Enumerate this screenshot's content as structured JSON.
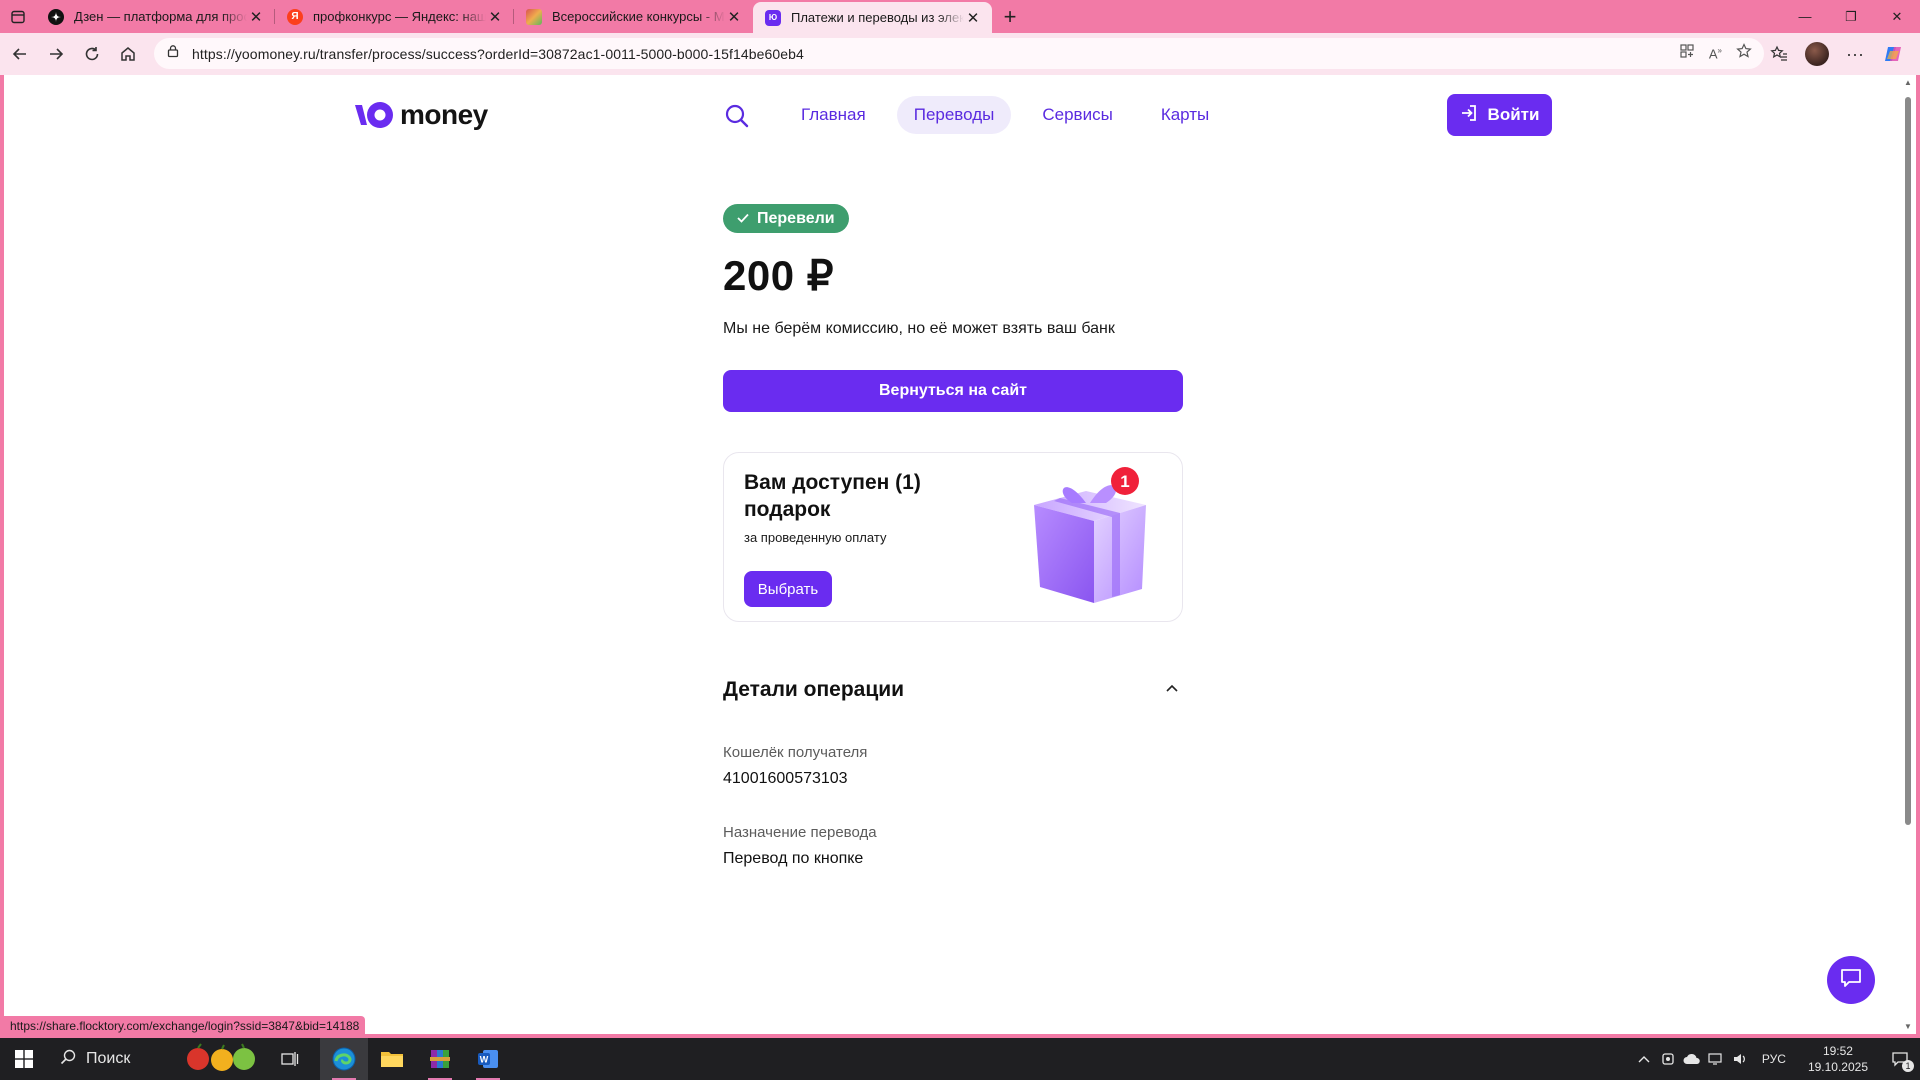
{
  "browser": {
    "tabs": [
      {
        "title": "Дзен — платформа для просмотра",
        "favicon": "dzen-icon",
        "active": false
      },
      {
        "title": "профконкурс — Яндекс: нашлось",
        "favicon": "yandex-icon",
        "active": false
      },
      {
        "title": "Всероссийские конкурсы - Меж",
        "favicon": "contest-icon",
        "active": false
      },
      {
        "title": "Платежи и переводы из электро",
        "favicon": "yoomoney-icon",
        "active": true
      }
    ],
    "url": "https://yoomoney.ru/transfer/process/success?orderId=30872ac1-0011-5000-b000-15f14be60eb4",
    "status_url": "https://share.flocktory.com/exchange/login?ssid=3847&bid=14188"
  },
  "site": {
    "logo_text": "money",
    "nav": [
      {
        "label": "Главная",
        "active": false
      },
      {
        "label": "Переводы",
        "active": true
      },
      {
        "label": "Сервисы",
        "active": false
      },
      {
        "label": "Карты",
        "active": false
      }
    ],
    "login_label": "Войти"
  },
  "result": {
    "badge": "Перевели",
    "amount": "200 ₽",
    "commission_note": "Мы не берём комиссию, но её может взять ваш банк",
    "back_button": "Вернуться на сайт"
  },
  "gift": {
    "title": "Вам доступен (1) подарок",
    "subtitle": "за проведенную оплату",
    "button": "Выбрать",
    "count_badge": "1"
  },
  "details": {
    "title": "Детали операции",
    "fields": [
      {
        "label": "Кошелёк получателя",
        "value": "41001600573103"
      },
      {
        "label": "Назначение перевода",
        "value": "Перевод по кнопке"
      }
    ]
  },
  "taskbar": {
    "search_label": "Поиск",
    "lang": "РУС",
    "time": "19:52",
    "date": "19.10.2025",
    "notifications": "1"
  },
  "colors": {
    "accent": "#6a2cf0",
    "success": "#3e9e6e",
    "browser_frame": "#f27aa6"
  }
}
